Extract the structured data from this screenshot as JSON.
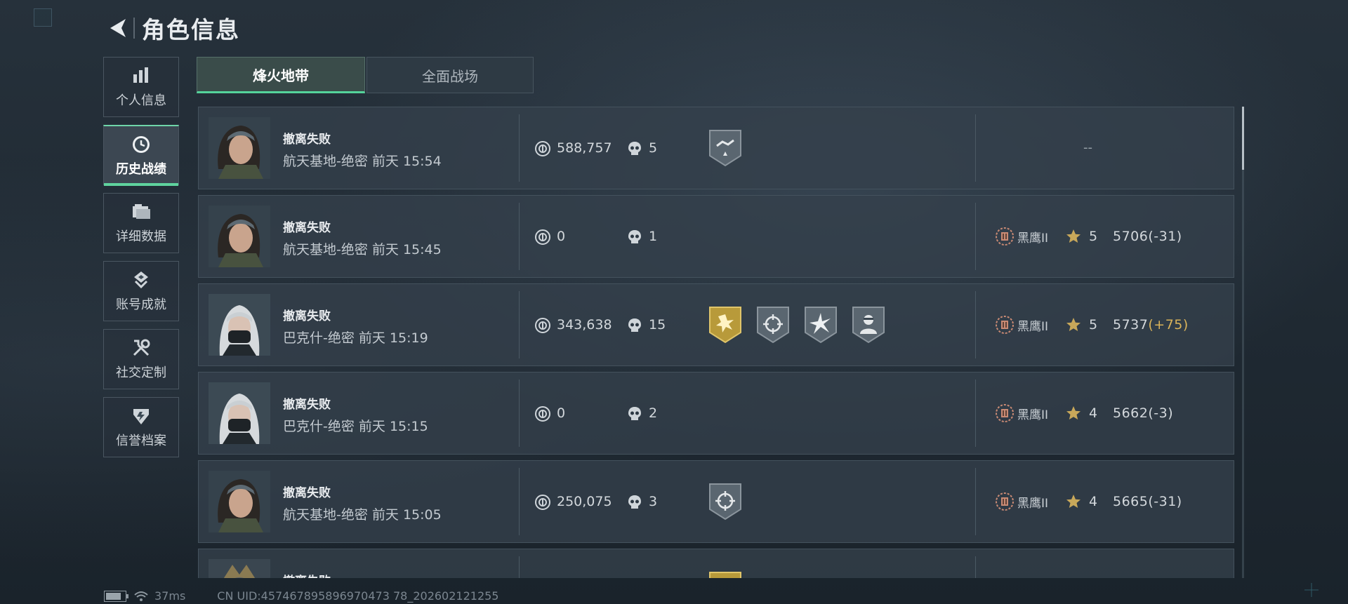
{
  "header": {
    "title": "角色信息"
  },
  "sidebar": {
    "items": [
      {
        "label": "个人信息",
        "icon": "bar-chart-icon",
        "active": false
      },
      {
        "label": "历史战绩",
        "icon": "clock-icon",
        "active": true
      },
      {
        "label": "详细数据",
        "icon": "folder-icon",
        "active": false
      },
      {
        "label": "账号成就",
        "icon": "achievement-icon",
        "active": false
      },
      {
        "label": "社交定制",
        "icon": "tools-icon",
        "active": false
      },
      {
        "label": "信誉档案",
        "icon": "shield-icon",
        "active": false
      }
    ]
  },
  "tabs": [
    {
      "label": "烽火地带",
      "active": true
    },
    {
      "label": "全面战场",
      "active": false
    }
  ],
  "records": [
    {
      "result": "撤离失败",
      "map": "航天基地-绝密",
      "time": "前天 15:54",
      "coins": "588,757",
      "kills": "5",
      "badges": [
        "handshake-badge"
      ],
      "rank": null,
      "placeholder": "--",
      "avatar": "dark"
    },
    {
      "result": "撤离失败",
      "map": "航天基地-绝密",
      "time": "前天 15:45",
      "coins": "0",
      "kills": "1",
      "badges": [],
      "rank": {
        "name": "黑鹰II",
        "stars": "5",
        "score": "5706",
        "delta": "(-31)",
        "positive": false
      },
      "avatar": "dark"
    },
    {
      "result": "撤离失败",
      "map": "巴克什-绝密",
      "time": "前天 15:19",
      "coins": "343,638",
      "kills": "15",
      "badges": [
        "explosion-gold-badge",
        "crosshair-badge",
        "burst-badge",
        "soldier-badge"
      ],
      "rank": {
        "name": "黑鹰II",
        "stars": "5",
        "score": "5737",
        "delta": "(+75)",
        "positive": true
      },
      "avatar": "silver"
    },
    {
      "result": "撤离失败",
      "map": "巴克什-绝密",
      "time": "前天 15:15",
      "coins": "0",
      "kills": "2",
      "badges": [],
      "rank": {
        "name": "黑鹰II",
        "stars": "4",
        "score": "5662",
        "delta": "(-3)",
        "positive": false
      },
      "avatar": "silver"
    },
    {
      "result": "撤离失败",
      "map": "航天基地-绝密",
      "time": "前天 15:05",
      "coins": "250,075",
      "kills": "3",
      "badges": [
        "crosshair-badge"
      ],
      "rank": {
        "name": "黑鹰II",
        "stars": "4",
        "score": "5665",
        "delta": "(-31)",
        "positive": false
      },
      "avatar": "dark"
    },
    {
      "result": "撤离失败",
      "map": "",
      "time": "",
      "coins": "",
      "kills": "",
      "badges": [
        "explosion-gold-badge"
      ],
      "rank": null,
      "placeholder": "",
      "avatar": "armor"
    }
  ],
  "footer": {
    "ping": "37ms",
    "uid": "CN UID:457467895896970473 78_202602121255"
  },
  "colors": {
    "accent": "#5fd39e",
    "positive_delta": "#d9b35a",
    "gold_badge": "#b89a3a"
  }
}
